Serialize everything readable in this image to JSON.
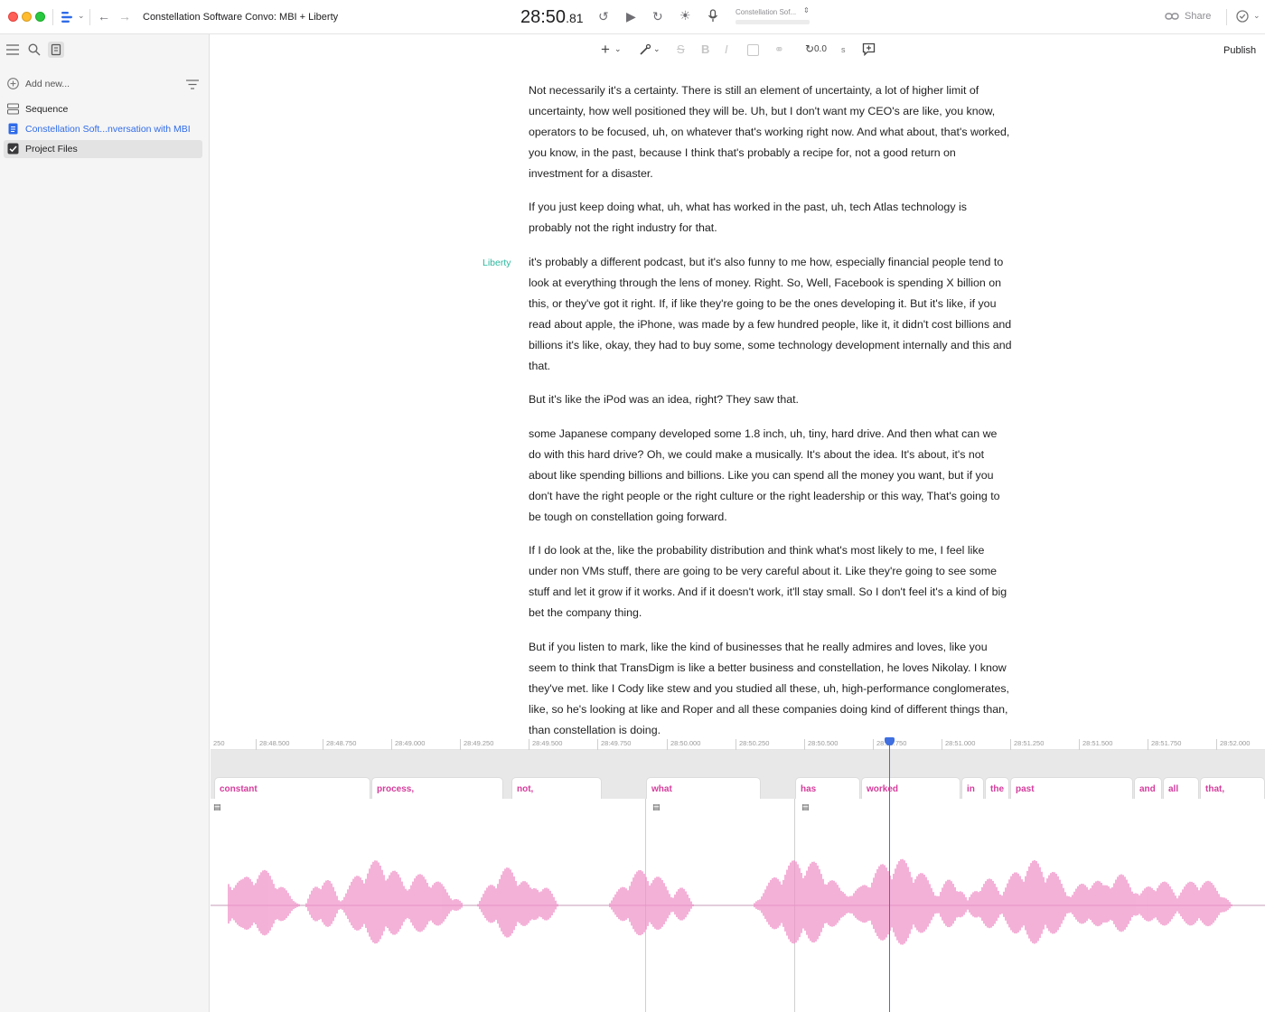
{
  "window": {
    "title": "Constellation Software Convo: MBI + Liberty",
    "timecode_main": "28:50",
    "timecode_frac": ".81",
    "clip_label": "Constellation Sof...",
    "share_label": "Share"
  },
  "sidebar": {
    "add_new": "Add new...",
    "items": [
      {
        "label": "Sequence",
        "icon": "sequence-icon"
      },
      {
        "label": "Constellation Soft...nversation with MBI",
        "icon": "document-icon"
      },
      {
        "label": "Project Files",
        "icon": "checkbox-icon"
      }
    ]
  },
  "toolbar": {
    "speed_value": "0.0",
    "speed_unit": "s",
    "publish_label": "Publish"
  },
  "transcript": {
    "speaker_liberty": "Liberty",
    "paragraphs": [
      "Not necessarily it's a certainty. There is still an element of uncertainty, a lot of higher limit of uncertainty, how well positioned they will be. Uh, but I don't want my CEO's are like, you know, operators to be focused, uh, on whatever that's working right now. And what about, that's worked, you know, in the past, because I think that's probably a recipe for, not a good return on investment for a disaster.",
      "If you just keep doing what, uh, what has worked in the past, uh, tech Atlas technology is probably not the right industry for that.",
      "it's probably a different podcast, but it's also funny to me how, especially financial people tend to look at everything through the lens of money. Right. So, Well, Facebook is spending X billion on this, or they've got it right. If, if like they're going to be the ones developing it. But it's like, if you read about apple, the iPhone, was made by a few hundred people, like it, it didn't cost billions and billions it's like, okay, they had to buy some, some technology development internally and this and that.",
      "But it's like the iPod was an idea, right? They saw that.",
      "some Japanese company developed some 1.8 inch, uh, tiny, hard drive. And then what can we do with this hard drive? Oh, we could make a musically. It's about the idea. It's about, it's not about like spending billions and billions. Like you can spend all the money you want, but if you don't have the right people or the right culture or the right leadership or this way, That's going to be tough on constellation going forward.",
      "If I do look at the, like the probability distribution and think what's most likely to me, I feel like under non VMs stuff, there are going to be very careful about it. Like they're going to see some stuff and let it grow if it works. And if it doesn't work, it'll stay small. So I don't feel it's a kind of big bet the company thing.",
      "But if you listen to mark, like the kind of businesses that he really admires and loves, like you seem to think that TransDigm is like a better business and constellation, he loves Nikolay. I know they've met. like I Cody like stew and you studied all these, uh, high-performance conglomerates, like, so he's looking at like and Roper and all these companies doing kind of different things than, than constellation is doing."
    ]
  },
  "timeline": {
    "ruler": [
      "250",
      "28:48.500",
      "28:48.750",
      "28:49.000",
      "28:49.250",
      "28:49.500",
      "28:49.750",
      "28:50.000",
      "28:50.250",
      "28:50.500",
      "28:50.750",
      "28:51.000",
      "28:51.250",
      "28:51.500",
      "28:51.750",
      "28:52.000"
    ],
    "words": [
      "constant",
      "process,",
      "not,",
      "what",
      "has",
      "worked",
      "in",
      "the",
      "past",
      "and",
      "all",
      "that,"
    ],
    "waveform_color": "#f090c8",
    "word_color": "#d43c9c",
    "playhead_color": "#3f6fe0"
  }
}
